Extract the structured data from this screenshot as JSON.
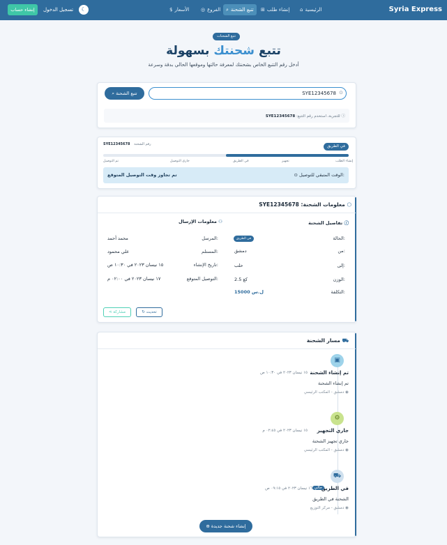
{
  "nav": {
    "brand": "Syria Express",
    "items": [
      {
        "label": "الرئيسية",
        "icon": "home-icon",
        "glyph": "⌂"
      },
      {
        "label": "إنشاء طلب",
        "icon": "plus-square-icon",
        "glyph": "⊞"
      },
      {
        "label": "تتبع الشحنة",
        "icon": "search-icon",
        "glyph": "⌕"
      },
      {
        "label": "الفروع",
        "icon": "map-pin-icon",
        "glyph": "◎"
      },
      {
        "label": "الأسعار",
        "icon": "dollar-icon",
        "glyph": "$"
      }
    ],
    "login": "تسجيل الدخول",
    "signup": "إنشاء حساب",
    "theme_icon": "moon-icon"
  },
  "hero": {
    "badge": "تتبع الشحنات",
    "title_part1": "تتبع",
    "title_accent": "شحنتك",
    "title_part2": "بسهولة",
    "subtitle": "أدخل رقم التتبع الخاص بشحنتك لمعرفة حالتها وموقعها الحالي بدقة وسرعة"
  },
  "search": {
    "value": "SYE12345678",
    "button": "تتبع الشحنة",
    "hint_prefix": "للتجربة، استخدم رقم التتبع:",
    "hint_code": "SYE12345678"
  },
  "progress": {
    "label": "رقم الشحنة",
    "tracking": "SYE12345678",
    "status": "في الطريق",
    "fill_fraction": 0.5,
    "steps": [
      "إنشاء الطلب",
      "تجهيز",
      "في الطريق",
      "جاري التوصيل",
      "تم التوصيل"
    ],
    "alert_label": "الوقت المتبقي للتوصيل:",
    "alert_value": "تم تجاوز وقت التوصيل المتوقع"
  },
  "info": {
    "title": "معلومات الشحنة:",
    "tracking": "SYE12345678",
    "details_title": "تفاصيل الشحنة",
    "sending_title": "معلومات الإرسال",
    "details": [
      {
        "label": "الحالة:",
        "value": "في الطريق"
      },
      {
        "label": "من:",
        "value": "دمشق"
      },
      {
        "label": "إلى:",
        "value": "حلب"
      },
      {
        "label": "الوزن:",
        "value": "2.5 كغ"
      },
      {
        "label": "التكلفة:",
        "value": "15000 ل.س"
      }
    ],
    "sending": [
      {
        "label": "المرسل:",
        "value": "محمد أحمد"
      },
      {
        "label": "المستلم:",
        "value": "علي محمود"
      },
      {
        "label": "تاريخ الإنشاء:",
        "value": "١٥ نيسان ٢٠٢٣ في ١٠:٣٠ ص"
      },
      {
        "label": "التوصيل المتوقع:",
        "value": "١٧ نيسان ٢٠٢٣ في ٠٢:٠٠ م"
      }
    ],
    "refresh": "تحديث",
    "share": "مشاركة"
  },
  "timeline": {
    "title": "مسار الشحنة",
    "events": [
      {
        "title": "تم إنشاء الشحنة",
        "time": "١٥ نيسان ٢٠٢٣ في ١٠:٣٠ ص",
        "desc": "تم إنشاء الشحنة",
        "loc": "دمشق - المكتب الرئيسي",
        "icon": "box-icon",
        "glyph": "▣",
        "color": "#9ed3ea",
        "fg": "#2f6c9d",
        "badge": ""
      },
      {
        "title": "جاري التجهيز",
        "time": "١٥ نيسان ٢٠٢٣ في ٠٢:٤٥ م",
        "desc": "جاري تجهيز الشحنة",
        "loc": "دمشق - المكتب الرئيسي",
        "icon": "gear-icon",
        "glyph": "⚙",
        "color": "#c9e38e",
        "fg": "#5c7a1f",
        "badge": ""
      },
      {
        "title": "في الطريق",
        "time": "١٦ نيسان ٢٠٢٣ في ٠٩:١٥ ص",
        "desc": "الشحنة في الطريق",
        "loc": "دمشق - مركز التوزيع",
        "icon": "truck-icon",
        "glyph": "⛟",
        "color": "#cfe0ee",
        "fg": "#2f6c9d",
        "badge": "حالي"
      }
    ],
    "new_button": "إنشاء شحنة جديدة"
  },
  "colors": {
    "primary": "#2f6c9d",
    "accent": "#3b8fcf",
    "teal": "#3fc7a7"
  }
}
